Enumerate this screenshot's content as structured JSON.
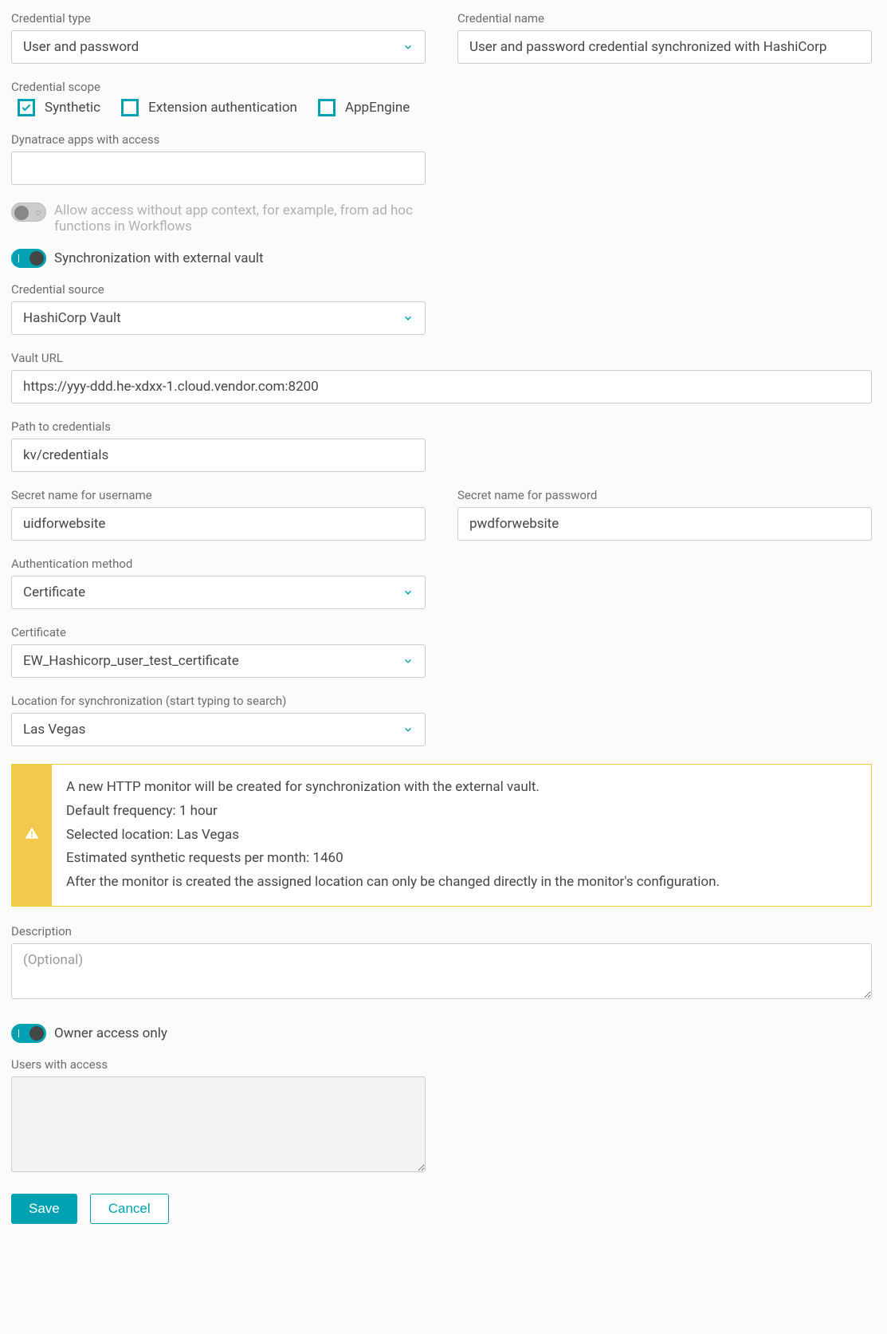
{
  "credential_type": {
    "label": "Credential type",
    "value": "User and password"
  },
  "credential_name": {
    "label": "Credential name",
    "value": "User and password credential synchronized with HashiCorp"
  },
  "credential_scope": {
    "label": "Credential scope",
    "synthetic": "Synthetic",
    "extension": "Extension authentication",
    "appengine": "AppEngine"
  },
  "apps_access": {
    "label": "Dynatrace apps with access",
    "value": ""
  },
  "allow_no_context": "Allow access without app context, for example, from ad hoc functions in Workflows",
  "sync_external": "Synchronization with external vault",
  "credential_source": {
    "label": "Credential source",
    "value": "HashiCorp Vault"
  },
  "vault_url": {
    "label": "Vault URL",
    "value": "https://yyy-ddd.he-xdxx-1.cloud.vendor.com:8200"
  },
  "path": {
    "label": "Path to credentials",
    "value": "kv/credentials"
  },
  "secret_user": {
    "label": "Secret name for username",
    "value": "uidforwebsite"
  },
  "secret_pass": {
    "label": "Secret name for password",
    "value": "pwdforwebsite"
  },
  "auth_method": {
    "label": "Authentication method",
    "value": "Certificate"
  },
  "certificate": {
    "label": "Certificate",
    "value": "EW_Hashicorp_user_test_certificate"
  },
  "location": {
    "label": "Location for synchronization (start typing to search)",
    "value": "Las Vegas"
  },
  "alert": {
    "l1": "A new HTTP monitor will be created for synchronization with the external vault.",
    "l2": "Default frequency: 1 hour",
    "l3": "Selected location: Las Vegas",
    "l4": "Estimated synthetic requests per month: 1460",
    "l5": "After the monitor is created the assigned location can only be changed directly in the monitor's configuration."
  },
  "description": {
    "label": "Description",
    "placeholder": "(Optional)",
    "value": ""
  },
  "owner_only": "Owner access only",
  "users_access": {
    "label": "Users with access",
    "value": ""
  },
  "buttons": {
    "save": "Save",
    "cancel": "Cancel"
  }
}
